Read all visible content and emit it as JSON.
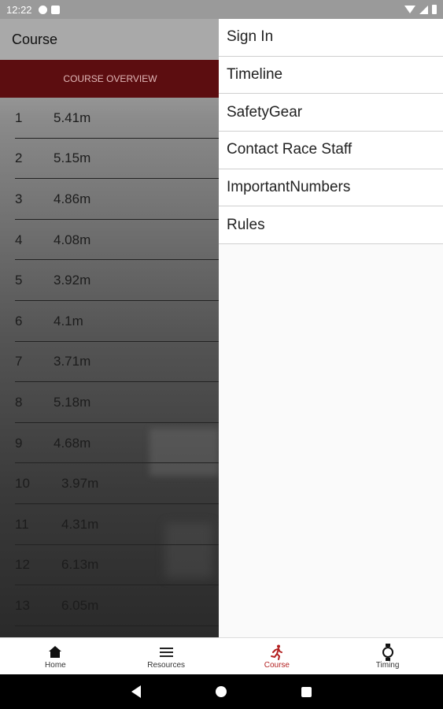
{
  "status_bar": {
    "time": "12:22"
  },
  "course": {
    "title": "Course",
    "overview_label": "COURSE OVERVIEW",
    "segments": [
      {
        "num": "1",
        "dist": "5.41m"
      },
      {
        "num": "2",
        "dist": "5.15m"
      },
      {
        "num": "3",
        "dist": "4.86m"
      },
      {
        "num": "4",
        "dist": "4.08m"
      },
      {
        "num": "5",
        "dist": "3.92m"
      },
      {
        "num": "6",
        "dist": "4.1m"
      },
      {
        "num": "7",
        "dist": "3.71m"
      },
      {
        "num": "8",
        "dist": "5.18m"
      },
      {
        "num": "9",
        "dist": "4.68m"
      },
      {
        "num": "10",
        "dist": "3.97m"
      },
      {
        "num": "11",
        "dist": "4.31m"
      },
      {
        "num": "12",
        "dist": "6.13m"
      },
      {
        "num": "13",
        "dist": "6.05m"
      }
    ]
  },
  "menu": {
    "items": [
      {
        "label": "Sign In"
      },
      {
        "label": "Timeline"
      },
      {
        "label": "SafetyGear"
      },
      {
        "label": "Contact Race Staff"
      },
      {
        "label": "ImportantNumbers"
      },
      {
        "label": "Rules"
      }
    ]
  },
  "bottom_nav": {
    "tabs": [
      {
        "label": "Home",
        "icon": "home-icon"
      },
      {
        "label": "Resources",
        "icon": "menu-icon"
      },
      {
        "label": "Course",
        "icon": "runner-icon"
      },
      {
        "label": "Timing",
        "icon": "watch-icon"
      }
    ],
    "active_color": "#b32020"
  },
  "colors": {
    "overview_bar": "#5c0d10",
    "accent": "#b32020"
  }
}
